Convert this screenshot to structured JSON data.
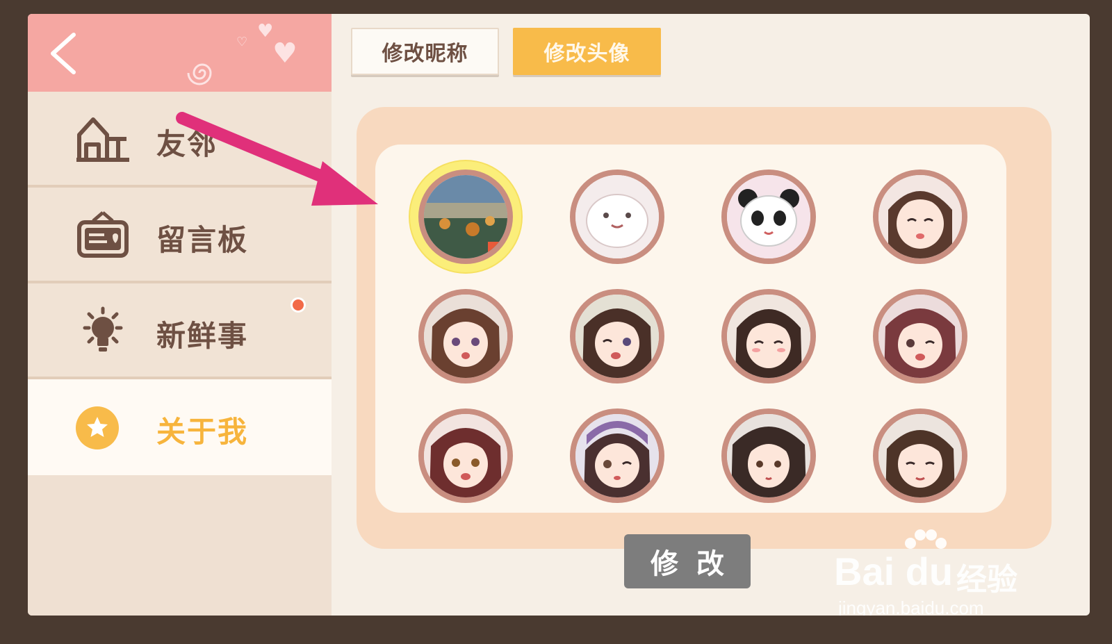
{
  "sidebar": {
    "items": [
      {
        "label": "友邻",
        "icon": "house-icon"
      },
      {
        "label": "留言板",
        "icon": "message-board-icon"
      },
      {
        "label": "新鲜事",
        "icon": "lightbulb-icon"
      },
      {
        "label": "关于我",
        "icon": "star-badge-icon"
      }
    ],
    "active_index": 3
  },
  "tabs": [
    {
      "label": "修改昵称"
    },
    {
      "label": "修改头像"
    }
  ],
  "avatars": {
    "selected_index": 0,
    "items": [
      "landscape-photo",
      "white-seal",
      "panda",
      "girl-smile",
      "girl-brown-hair",
      "girl-wink",
      "girl-happy",
      "girl-red-hair",
      "girl-auburn",
      "girl-hat-wink",
      "girl-dark-hair",
      "girl-bob"
    ]
  },
  "submit": {
    "label": "修改"
  },
  "watermark": {
    "brand": "Bai du",
    "cn": "经验",
    "url": "jingyan.baidu.com"
  },
  "colors": {
    "accent": "#f8bb4a",
    "pink": "#f5a7a2",
    "arrow": "#e0307a"
  }
}
